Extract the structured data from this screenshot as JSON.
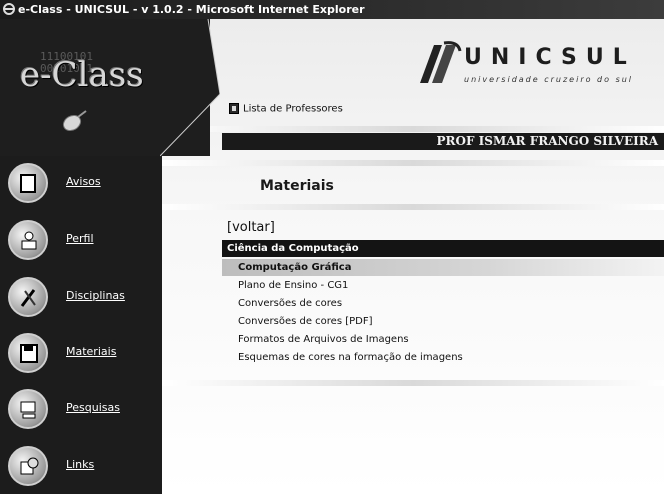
{
  "window": {
    "title": "e-Class - UNICSUL - v 1.0.2 - Microsoft Internet Explorer"
  },
  "logo": {
    "text": "e-Class",
    "binary": "11100101\n00101011"
  },
  "brand": {
    "name": "UNICSUL",
    "tagline": "universidade cruzeiro do sul"
  },
  "nav": [
    {
      "label": "Avisos",
      "icon": "notepad-icon"
    },
    {
      "label": "Perfil",
      "icon": "person-icon"
    },
    {
      "label": "Disciplinas",
      "icon": "tools-icon"
    },
    {
      "label": "Materiais",
      "icon": "floppy-disk-icon"
    },
    {
      "label": "Pesquisas",
      "icon": "computer-icon"
    },
    {
      "label": "Links",
      "icon": "globe-icon"
    }
  ],
  "lista_professores": "Lista de Professores",
  "professor": "PROF ISMAR FRANGO SILVEIRA",
  "section_title": "Materiais",
  "voltar": "[voltar]",
  "category": "Ciência da Computação",
  "subcategory": "Computação Gráfica",
  "items": [
    "Plano de Ensino - CG1",
    "Conversões de cores",
    "Conversões de cores [PDF]",
    "Formatos de Arquivos de Imagens",
    "Esquemas de cores na formação de imagens"
  ]
}
